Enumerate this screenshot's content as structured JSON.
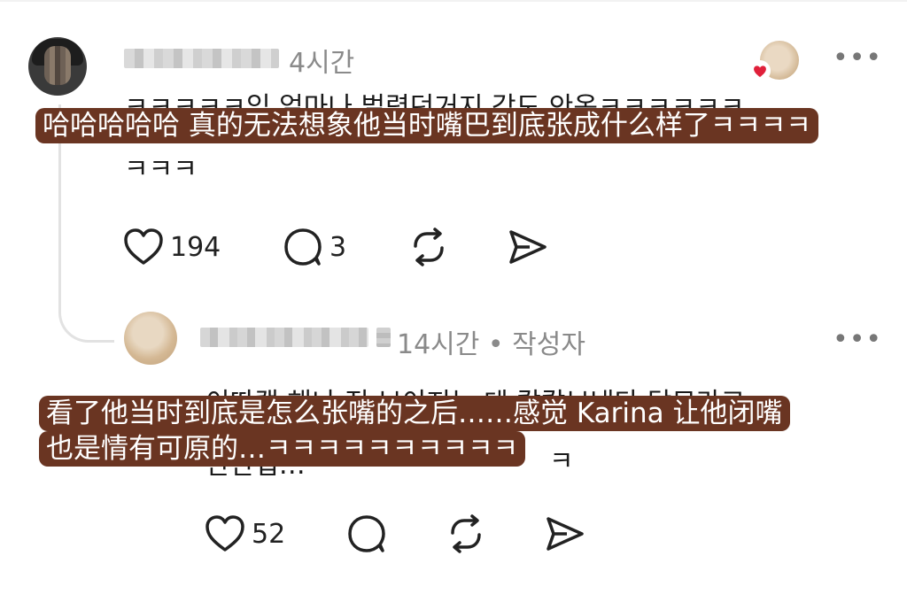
{
  "comment": {
    "time": "4시간",
    "text_line1": "ㅋㅋㅋㅋㅋ입 얼마나 벌렸던거지 감도 안옴ㅋㅋㅋㅋㅋㅋ",
    "text_line2": "ㅋㅋㅋ",
    "caption": "哈哈哈哈哈 真的无法想象他当时嘴巴到底张成什么样了ㅋㅋㅋㅋ",
    "likes": "194",
    "replies": "3"
  },
  "reply": {
    "time": "14시간",
    "author_tag": "작성자",
    "text_line1": "이따캡 해놔 진 보이지는 데 칼칼보냈다 닫모라고",
    "text_line2": "얀얀접…",
    "text_tail": "ㅋ",
    "caption_line1": "看了他当时到底是怎么张嘴的之后……感觉 Karina 让他闭嘴",
    "caption_line2": "也是情有可原的…ㅋㅋㅋㅋㅋㅋㅋㅋㅋㅋ",
    "likes": "52"
  },
  "icons": {
    "like": "heart-icon",
    "comment": "comment-bubble-icon",
    "repost": "repost-icon",
    "share": "send-icon",
    "more": "more-dots-icon"
  },
  "colors": {
    "caption_bg": "#6a3522",
    "liked_heart": "#e0203a"
  }
}
